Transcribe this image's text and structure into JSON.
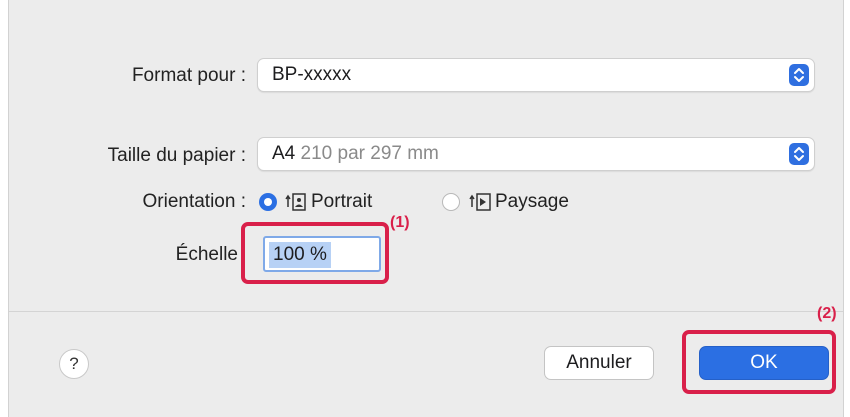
{
  "format": {
    "label": "Format pour :",
    "value": "BP-xxxxx"
  },
  "paper": {
    "label": "Taille du papier :",
    "size": "A4",
    "dimensions": "210 par 297 mm"
  },
  "orientation": {
    "label": "Orientation :",
    "options": [
      {
        "label": "Portrait",
        "selected": true
      },
      {
        "label": "Paysage",
        "selected": false
      }
    ]
  },
  "scale": {
    "label": "Échelle",
    "value": "100 %"
  },
  "callouts": {
    "one": "(1)",
    "two": "(2)"
  },
  "buttons": {
    "help": "?",
    "cancel": "Annuler",
    "ok": "OK"
  },
  "colors": {
    "accent": "#2b6fe3",
    "highlight": "#d9204a"
  }
}
